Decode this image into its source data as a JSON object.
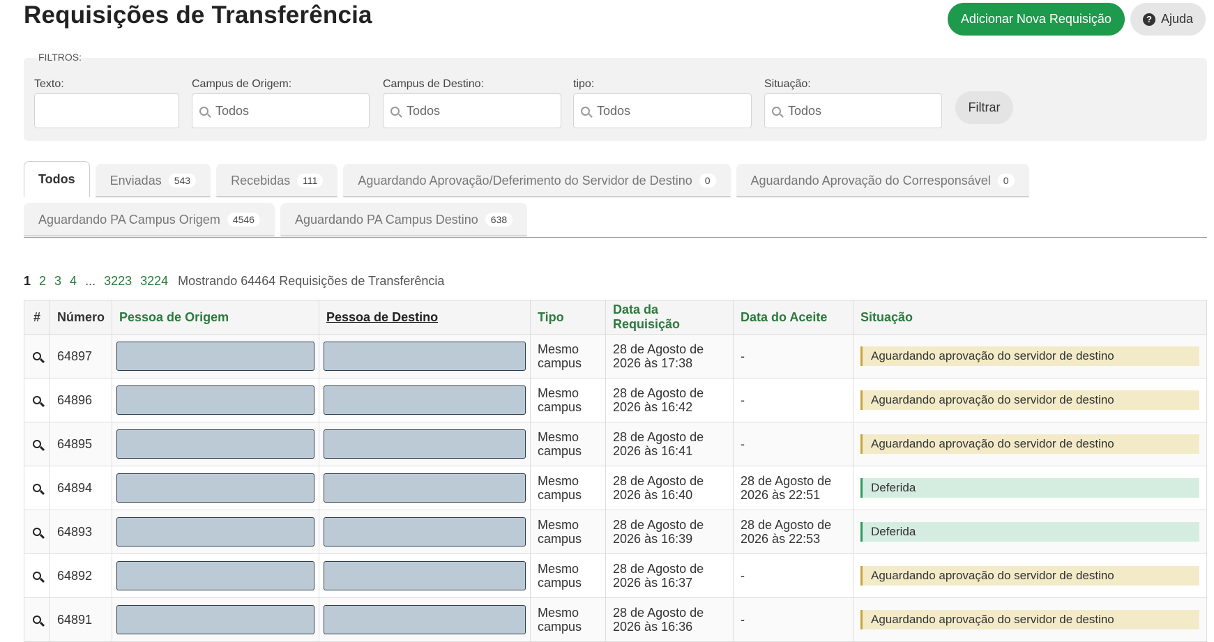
{
  "header": {
    "title": "Requisições de Transferência",
    "add_button": "Adicionar Nova Requisição",
    "help_button": "Ajuda"
  },
  "filters": {
    "legend": "FILTROS:",
    "texto_label": "Texto:",
    "texto_value": "",
    "campus_origem_label": "Campus de Origem:",
    "campus_origem_value": "Todos",
    "campus_destino_label": "Campus de Destino:",
    "campus_destino_value": "Todos",
    "tipo_label": "tipo:",
    "tipo_value": "Todos",
    "situacao_label": "Situação:",
    "situacao_value": "Todos",
    "filter_button": "Filtrar"
  },
  "tabs": [
    {
      "label": "Todos",
      "count": null,
      "active": true
    },
    {
      "label": "Enviadas",
      "count": "543"
    },
    {
      "label": "Recebidas",
      "count": "111"
    },
    {
      "label": "Aguardando Aprovação/Deferimento do Servidor de Destino",
      "count": "0"
    },
    {
      "label": "Aguardando Aprovação do Corresponsável",
      "count": "0"
    },
    {
      "label": "Aguardando PA Campus Origem",
      "count": "4546"
    },
    {
      "label": "Aguardando PA Campus Destino",
      "count": "638"
    }
  ],
  "pagination": {
    "current": "1",
    "p2": "2",
    "p3": "3",
    "p4": "4",
    "dots": "...",
    "p_prev_last": "3223",
    "p_last": "3224",
    "info": "Mostrando 64464 Requisições de Transferência"
  },
  "table": {
    "headers": {
      "hash": "#",
      "numero": "Número",
      "origem": "Pessoa de Origem",
      "destino": "Pessoa de Destino",
      "tipo": "Tipo",
      "data_req": "Data da Requisição",
      "data_aceite": "Data do Aceite",
      "situacao": "Situação"
    },
    "rows": [
      {
        "numero": "64897",
        "tipo": "Mesmo campus",
        "data_req": "28 de Agosto de 2026 às 17:38",
        "data_aceite": "-",
        "situacao": "Aguardando aprovação do servidor de destino"
      },
      {
        "numero": "64896",
        "tipo": "Mesmo campus",
        "data_req": "28 de Agosto de 2026 às 16:42",
        "data_aceite": "-",
        "situacao": "Aguardando aprovação do servidor de destino"
      },
      {
        "numero": "64895",
        "tipo": "Mesmo campus",
        "data_req": "28 de Agosto de 2026 às 16:41",
        "data_aceite": "-",
        "situacao": "Aguardando aprovação do servidor de destino"
      },
      {
        "numero": "64894",
        "tipo": "Mesmo campus",
        "data_req": "28 de Agosto de 2026 às 16:40",
        "data_aceite": "28 de Agosto de 2026 às 22:51",
        "situacao": "Deferida"
      },
      {
        "numero": "64893",
        "tipo": "Mesmo campus",
        "data_req": "28 de Agosto de 2026 às 16:39",
        "data_aceite": "28 de Agosto de 2026 às 22:53",
        "situacao": "Deferida"
      },
      {
        "numero": "64892",
        "tipo": "Mesmo campus",
        "data_req": "28 de Agosto de 2026 às 16:37",
        "data_aceite": "-",
        "situacao": "Aguardando aprovação do servidor de destino"
      },
      {
        "numero": "64891",
        "tipo": "Mesmo campus",
        "data_req": "28 de Agosto de 2026 às 16:36",
        "data_aceite": "-",
        "situacao": "Aguardando aprovação do servidor de destino"
      }
    ]
  }
}
